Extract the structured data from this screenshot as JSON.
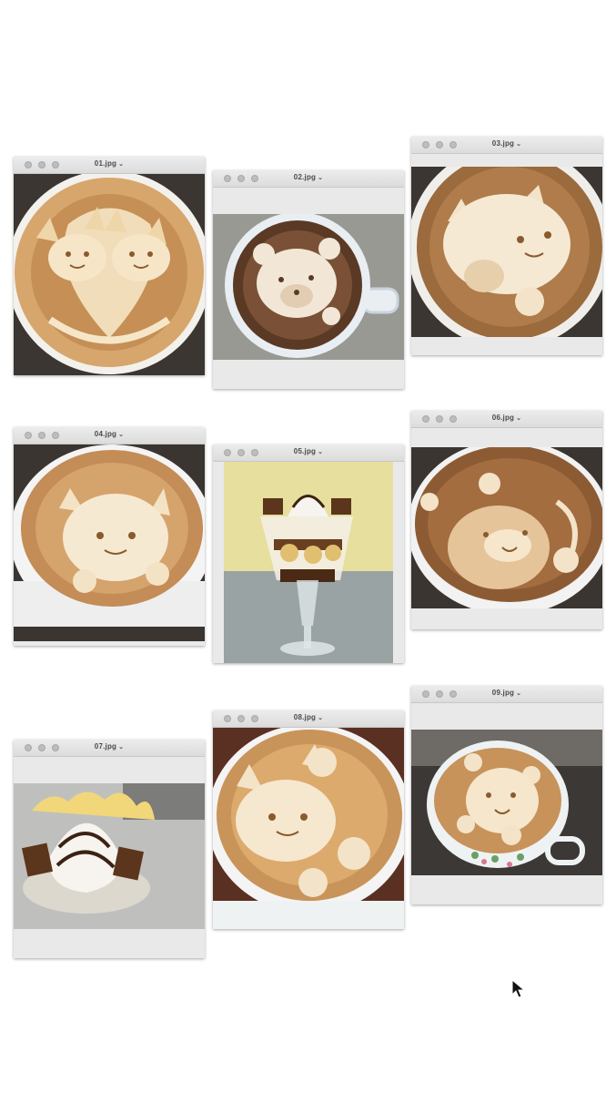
{
  "windows": [
    {
      "title": "01.jpg",
      "subject": "two cats latte art"
    },
    {
      "title": "02.jpg",
      "subject": "bear latte art"
    },
    {
      "title": "03.jpg",
      "subject": "cat holding cup latte art"
    },
    {
      "title": "04.jpg",
      "subject": "cat latte art"
    },
    {
      "title": "05.jpg",
      "subject": "chocolate banana parfait glass"
    },
    {
      "title": "06.jpg",
      "subject": "bear with leaf latte art"
    },
    {
      "title": "07.jpg",
      "subject": "banana chocolate sundae"
    },
    {
      "title": "08.jpg",
      "subject": "cat with bear latte art"
    },
    {
      "title": "09.jpg",
      "subject": "bear latte in floral cup"
    }
  ],
  "chevron_glyph": "⌄",
  "colors": {
    "foam": "#f2e2c4",
    "crema": "#c8955a",
    "dark_crema": "#9a6434",
    "cup": "#f4f4f4",
    "table": "#3a3530"
  }
}
